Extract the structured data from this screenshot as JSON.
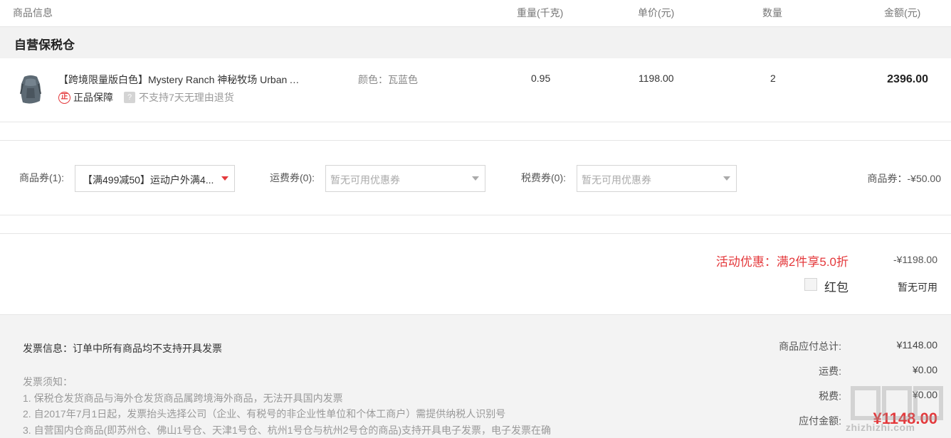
{
  "header": {
    "col_info": "商品信息",
    "col_weight": "重量(千克)",
    "col_price": "单价(元)",
    "col_qty": "数量",
    "col_amount": "金额(元)"
  },
  "warehouse": {
    "title": "自营保税仓"
  },
  "product": {
    "name": "【跨境限量版白色】Mystery Ranch 神秘牧场 Urban Assault 城市突击 双肩背包",
    "genuine_label": "正品保障",
    "genuine_icon_text": "正",
    "no_return_icon_text": "?",
    "no_return_label": "不支持7天无理由退货",
    "color": "颜色：瓦蓝色",
    "weight": "0.95",
    "unit_price": "1198.00",
    "quantity": "2",
    "amount": "2396.00"
  },
  "coupons": {
    "goods_label": "商品券(1):",
    "goods_value": "【满499减50】运动户外满4...",
    "shipping_label": "运费券(0):",
    "shipping_value": "暂无可用优惠券",
    "tax_label": "税费券(0):",
    "tax_value": "暂无可用优惠券",
    "summary": "商品券：-¥50.00"
  },
  "promotions": {
    "activity_label": "活动优惠：满2件享5.0折",
    "activity_value": "-¥1198.00",
    "redpacket_label": "红包",
    "redpacket_value": "暂无可用",
    "redpacket_checked": false
  },
  "invoice": {
    "title": "发票信息：订单中所有商品均不支持开具发票",
    "notes": [
      "发票须知：",
      "1. 保税仓发货商品与海外仓发货商品属跨境海外商品，无法开具国内发票",
      "2. 自2017年7月1日起，发票抬头选择公司（企业、有税号的非企业性单位和个体工商户）需提供纳税人识别号",
      "3. 自营国内仓商品(即苏州仓、佛山1号仓、天津1号仓、杭州1号仓与杭州2号仓的商品)支持开具电子发票，电子发票在确"
    ]
  },
  "summary": {
    "subtotal_label": "商品应付总计:",
    "subtotal_value": "¥1148.00",
    "shipping_label": "运费:",
    "shipping_value": "¥0.00",
    "tax_label": "税费:",
    "tax_value": "¥0.00",
    "total_label": "应付金额:",
    "total_value": "¥1148.00"
  },
  "watermark": {
    "text": "zhizhizhi.com"
  },
  "colors": {
    "accent_red": "#e4393c",
    "footer_bg": "#f3f3f3",
    "warehouse_bg": "#f2f2f2"
  }
}
